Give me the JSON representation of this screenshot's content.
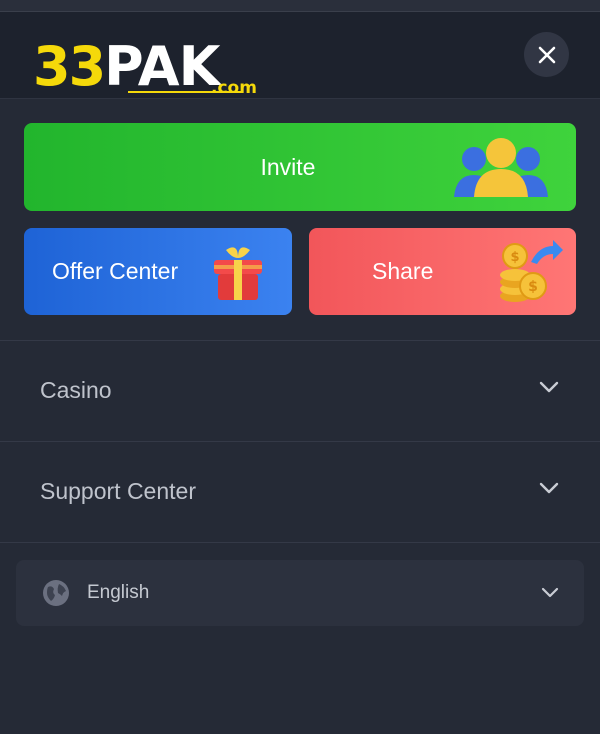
{
  "header": {
    "logo_number": "33",
    "logo_text": "PAK",
    "logo_domain": ".com",
    "close_icon": "close-icon"
  },
  "actions": {
    "invite_label": "Invite",
    "offer_label": "Offer Center",
    "share_label": "Share"
  },
  "menu": {
    "items": [
      {
        "label": "Casino",
        "icon": "chevron-down-icon"
      },
      {
        "label": "Support Center",
        "icon": "chevron-down-icon"
      }
    ]
  },
  "language": {
    "label": "English",
    "icon": "globe-icon"
  },
  "colors": {
    "background": "#252a36",
    "header": "#1d222d",
    "invite": "#2cc234",
    "offer": "#2b6fe3",
    "share": "#f86466",
    "logo_yellow": "#f5d90a"
  }
}
